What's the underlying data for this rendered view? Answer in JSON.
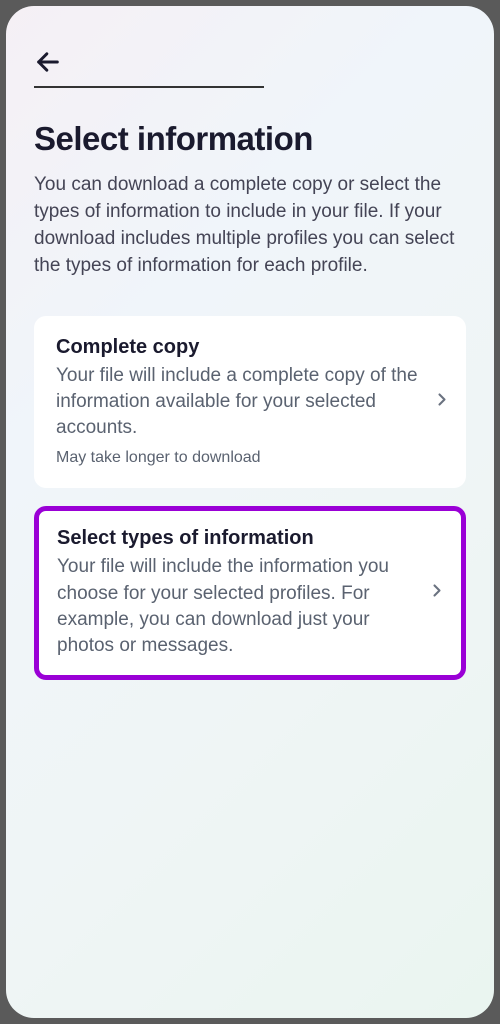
{
  "header": {
    "title": "Select information",
    "description": "You can download a complete copy or select the types of information to include in your file. If your download includes multiple profiles you can select the types of information for each profile."
  },
  "options": [
    {
      "title": "Complete copy",
      "description": "Your file will include a complete copy of the information available for your selected accounts.",
      "note": "May take longer to download",
      "highlighted": false
    },
    {
      "title": "Select types of information",
      "description": "Your file will include the information you choose for your selected profiles. For example, you can download just your photos or messages.",
      "note": "",
      "highlighted": true
    }
  ]
}
